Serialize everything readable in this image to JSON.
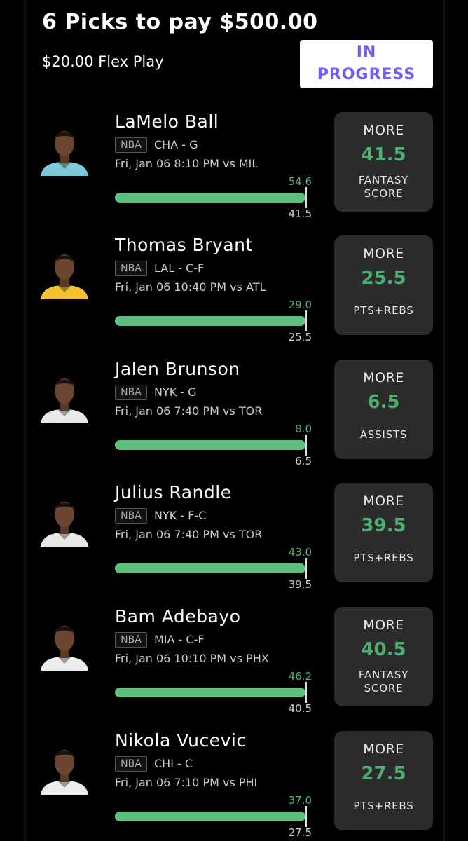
{
  "header": {
    "title": "6 Picks to pay $500.00",
    "subtitle": "$20.00 Flex Play",
    "status": "IN\nPROGRESS",
    "status_color": "#6b5df5"
  },
  "colors": {
    "accent_green": "#4cae6f",
    "bar_fill": "#5dc07f",
    "card_bg": "#2b2b2b"
  },
  "picks": [
    {
      "name": "LaMelo Ball",
      "league": "NBA",
      "team_pos": "CHA - G",
      "game": "Fri, Jan 06 8:10 PM  vs MIL",
      "actual": "54.6",
      "line": "41.5",
      "progress": 1.0,
      "direction": "MORE",
      "stat": "FANTASY SCORE",
      "jersey_color": "#7ec8d8"
    },
    {
      "name": "Thomas Bryant",
      "league": "NBA",
      "team_pos": "LAL - C-F",
      "game": "Fri, Jan 06 10:40 PM  vs ATL",
      "actual": "29.0",
      "line": "25.5",
      "progress": 1.0,
      "direction": "MORE",
      "stat": "PTS+REBS",
      "jersey_color": "#f2c230"
    },
    {
      "name": "Jalen Brunson",
      "league": "NBA",
      "team_pos": "NYK - G",
      "game": "Fri, Jan 06 7:40 PM  vs TOR",
      "actual": "8.0",
      "line": "6.5",
      "progress": 1.0,
      "direction": "MORE",
      "stat": "ASSISTS",
      "jersey_color": "#e8e8e8"
    },
    {
      "name": "Julius Randle",
      "league": "NBA",
      "team_pos": "NYK - F-C",
      "game": "Fri, Jan 06 7:40 PM  vs TOR",
      "actual": "43.0",
      "line": "39.5",
      "progress": 1.0,
      "direction": "MORE",
      "stat": "PTS+REBS",
      "jersey_color": "#e8e8e8"
    },
    {
      "name": "Bam Adebayo",
      "league": "NBA",
      "team_pos": "MIA - C-F",
      "game": "Fri, Jan 06 10:10 PM  vs PHX",
      "actual": "46.2",
      "line": "40.5",
      "progress": 1.0,
      "direction": "MORE",
      "stat": "FANTASY SCORE",
      "jersey_color": "#ececec"
    },
    {
      "name": "Nikola Vucevic",
      "league": "NBA",
      "team_pos": "CHI - C",
      "game": "Fri, Jan 06 7:10 PM  vs PHI",
      "actual": "37.0",
      "line": "27.5",
      "progress": 1.0,
      "direction": "MORE",
      "stat": "PTS+REBS",
      "jersey_color": "#ececec"
    }
  ]
}
